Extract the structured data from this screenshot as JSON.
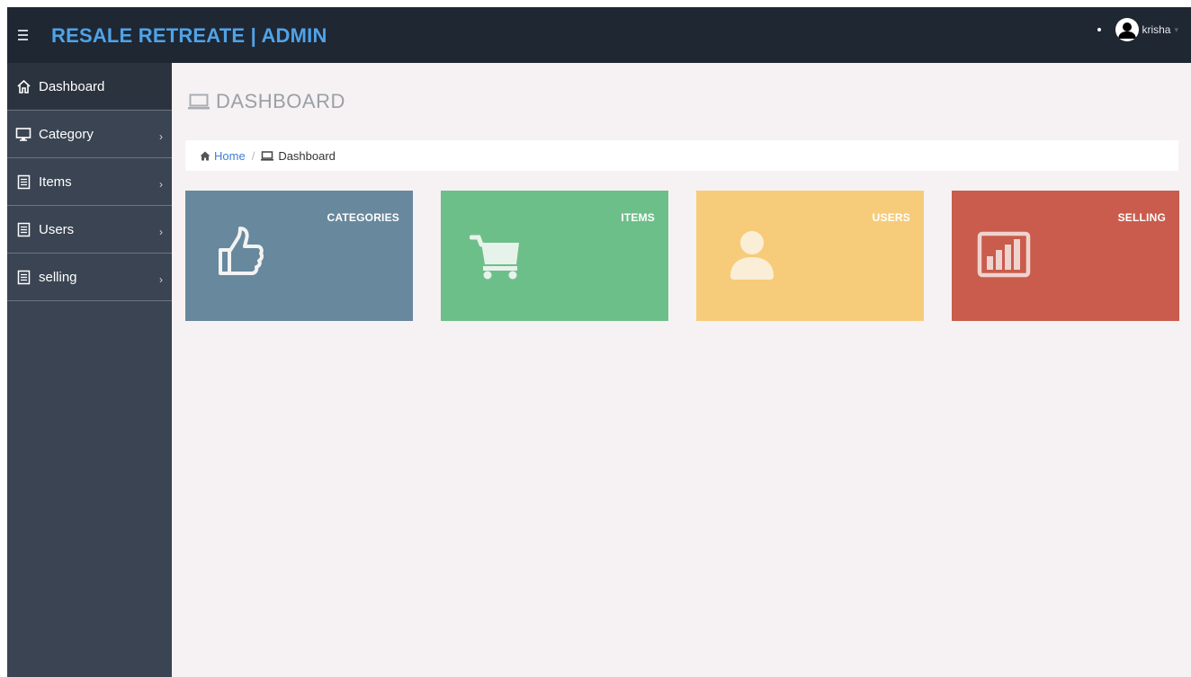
{
  "header": {
    "brand": "RESALE RETREATE | ADMIN",
    "username": "krisha",
    "caret": "▾"
  },
  "sidebar": {
    "items": [
      {
        "label": "Dashboard",
        "icon": "home-icon",
        "active": true
      },
      {
        "label": "Category",
        "icon": "monitor-icon",
        "chevron": "›"
      },
      {
        "label": "Items",
        "icon": "document-icon",
        "chevron": "›"
      },
      {
        "label": "Users",
        "icon": "document-icon",
        "chevron": "›"
      },
      {
        "label": "selling",
        "icon": "document-icon",
        "chevron": "›"
      }
    ]
  },
  "page": {
    "title": "DASHBOARD"
  },
  "breadcrumb": {
    "home": "Home",
    "separator": "/",
    "current": "Dashboard"
  },
  "cards": [
    {
      "label": "CATEGORIES",
      "icon": "thumbs-up-icon",
      "color": "#68889d"
    },
    {
      "label": "ITEMS",
      "icon": "cart-icon",
      "color": "#6dbf89"
    },
    {
      "label": "USERS",
      "icon": "user-icon",
      "color": "#f6cc7a"
    },
    {
      "label": "SELLING",
      "icon": "bar-chart-icon",
      "color": "#c95c4c"
    }
  ],
  "colors": {
    "topbar": "#1f2733",
    "brand": "#4fa3e8",
    "sidebar": "#3a4452",
    "sidebar_active": "#2b333e",
    "content_bg": "#f6f2f3",
    "link": "#3d7fd8"
  }
}
